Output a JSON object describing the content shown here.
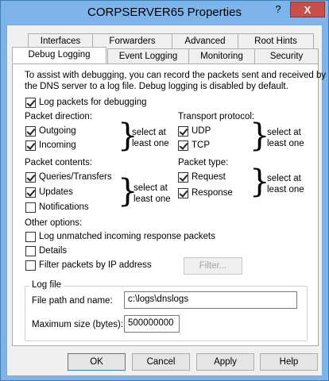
{
  "window": {
    "title": "CORPSERVER65 Properties",
    "help_glyph": "?",
    "close_glyph": "X"
  },
  "tabs_row1": [
    "Interfaces",
    "Forwarders",
    "Advanced",
    "Root Hints"
  ],
  "tabs_row2": [
    "Debug Logging",
    "Event Logging",
    "Monitoring",
    "Security"
  ],
  "selected_tab": "Debug Logging",
  "debug": {
    "intro": [
      "To assist with debugging, you can record the packets sent and received by",
      "the DNS server to a log file. Debug logging is disabled by default."
    ],
    "log_packets": {
      "label": "Log packets for debugging",
      "checked": true
    },
    "packet_direction": {
      "heading": "Packet direction:",
      "outgoing": {
        "label": "Outgoing",
        "checked": true
      },
      "incoming": {
        "label": "Incoming",
        "checked": true
      },
      "note": [
        "select at",
        "least one"
      ]
    },
    "transport": {
      "heading": "Transport protocol:",
      "udp": {
        "label": "UDP",
        "checked": true
      },
      "tcp": {
        "label": "TCP",
        "checked": true
      },
      "note": [
        "select at",
        "least one"
      ]
    },
    "packet_contents": {
      "heading": "Packet contents:",
      "queries": {
        "label": "Queries/Transfers",
        "checked": true
      },
      "updates": {
        "label": "Updates",
        "checked": true
      },
      "notifications": {
        "label": "Notifications",
        "checked": false
      },
      "note": [
        "select at",
        "least one"
      ]
    },
    "packet_type": {
      "heading": "Packet type:",
      "request": {
        "label": "Request",
        "checked": true
      },
      "response": {
        "label": "Response",
        "checked": true
      },
      "note": [
        "select at",
        "least one"
      ]
    },
    "other": {
      "heading": "Other options:",
      "log_unmatched": {
        "label": "Log unmatched incoming response packets",
        "checked": false
      },
      "details": {
        "label": "Details",
        "checked": false
      },
      "filter_ip": {
        "label": "Filter packets by IP address",
        "checked": false
      },
      "filter_button": "Filter..."
    },
    "log_file": {
      "heading": "Log file",
      "path_label": "File path and name:",
      "path_value": "c:\\logs\\dnslogs",
      "size_label": "Maximum size (bytes):",
      "size_value": "500000000"
    }
  },
  "buttons": {
    "ok": "OK",
    "cancel": "Cancel",
    "apply": "Apply",
    "help": "Help"
  }
}
